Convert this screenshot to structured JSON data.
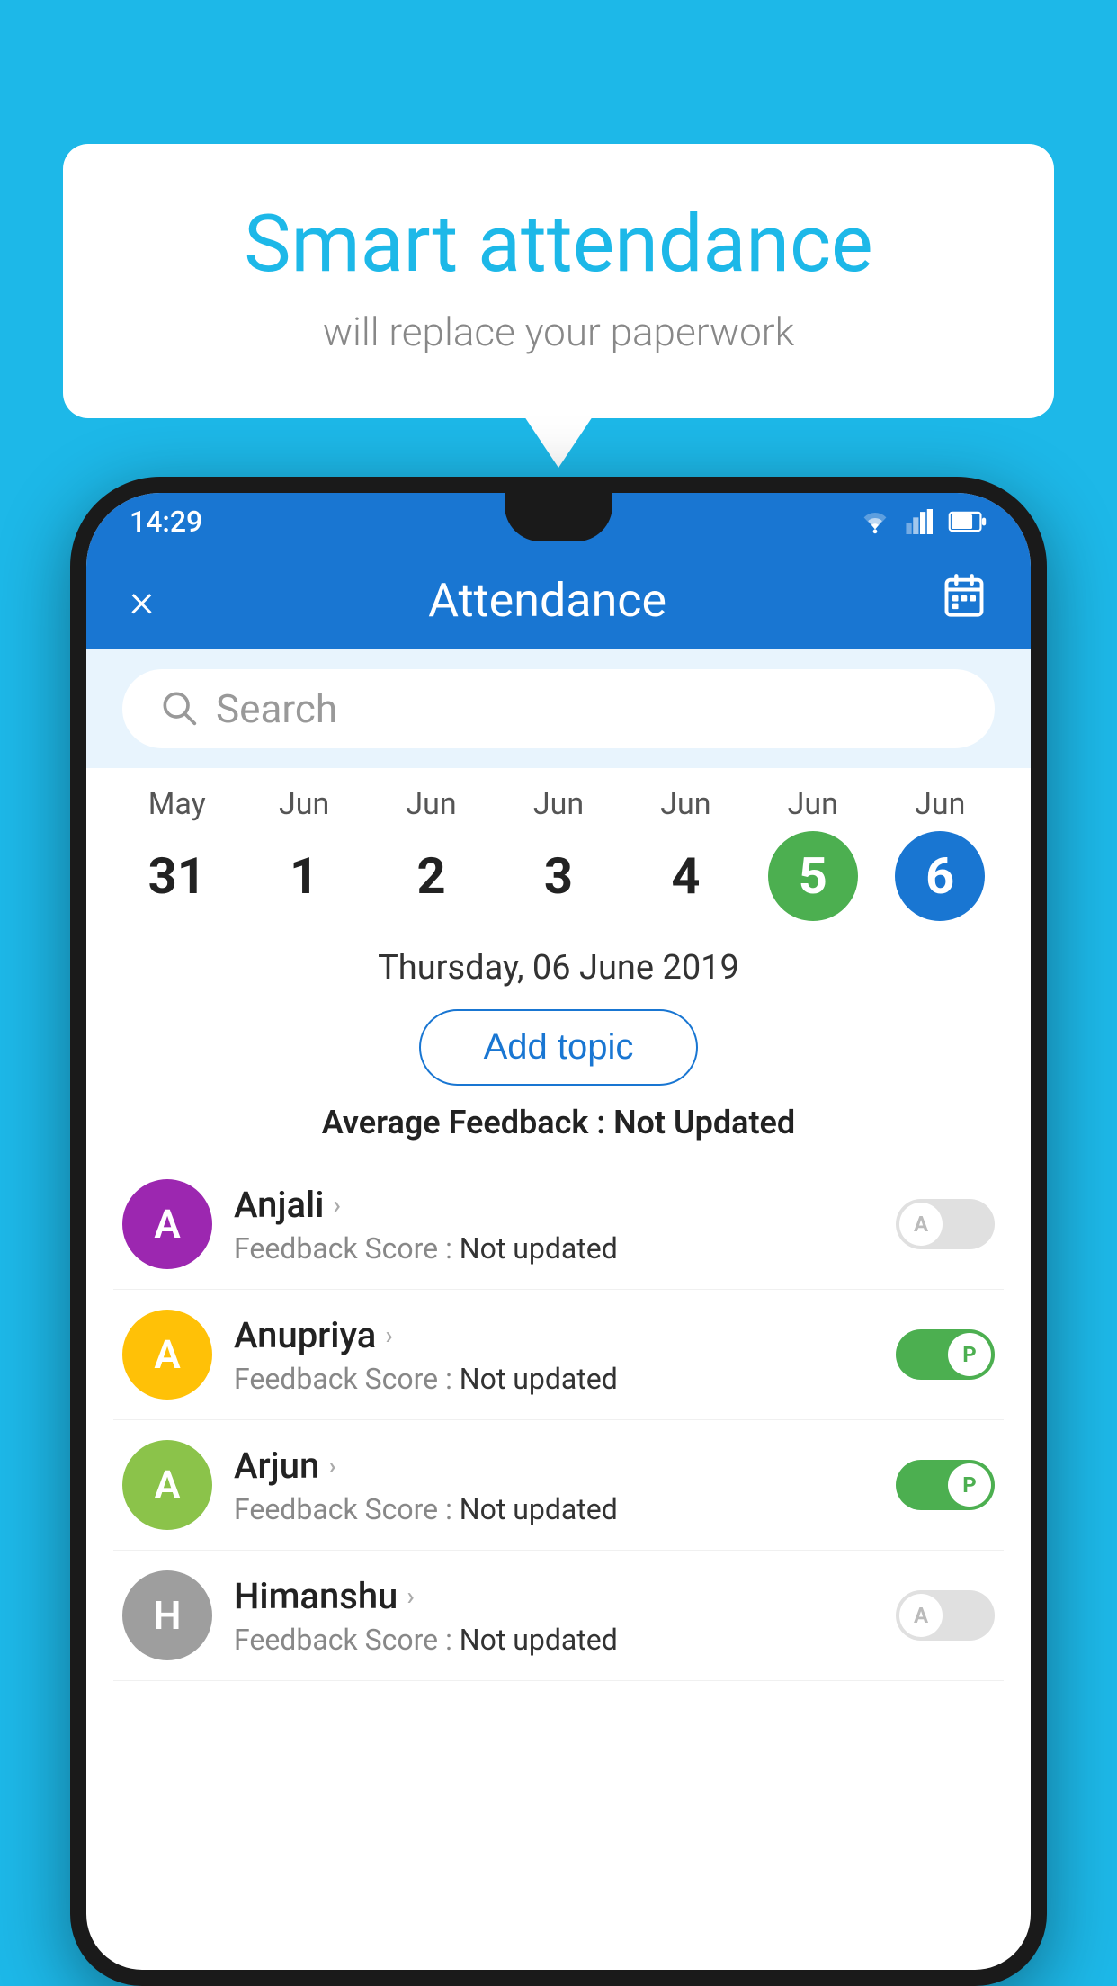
{
  "background_color": "#1DB8E8",
  "bubble": {
    "title": "Smart attendance",
    "subtitle": "will replace your paperwork"
  },
  "phone": {
    "status_bar": {
      "time": "14:29"
    },
    "header": {
      "close_label": "×",
      "title": "Attendance",
      "calendar_icon": "📅"
    },
    "search": {
      "placeholder": "Search"
    },
    "calendar": {
      "days": [
        {
          "month": "May",
          "date": "31",
          "state": "normal"
        },
        {
          "month": "Jun",
          "date": "1",
          "state": "normal"
        },
        {
          "month": "Jun",
          "date": "2",
          "state": "normal"
        },
        {
          "month": "Jun",
          "date": "3",
          "state": "normal"
        },
        {
          "month": "Jun",
          "date": "4",
          "state": "normal"
        },
        {
          "month": "Jun",
          "date": "5",
          "state": "today"
        },
        {
          "month": "Jun",
          "date": "6",
          "state": "selected"
        }
      ]
    },
    "selected_date": "Thursday, 06 June 2019",
    "add_topic_label": "Add topic",
    "avg_feedback_label": "Average Feedback :",
    "avg_feedback_value": "Not Updated",
    "students": [
      {
        "name": "Anjali",
        "avatar_letter": "A",
        "avatar_color": "#9C27B0",
        "feedback_label": "Feedback Score :",
        "feedback_value": "Not updated",
        "attendance": "absent",
        "toggle_letter": "A"
      },
      {
        "name": "Anupriya",
        "avatar_letter": "A",
        "avatar_color": "#FFC107",
        "feedback_label": "Feedback Score :",
        "feedback_value": "Not updated",
        "attendance": "present",
        "toggle_letter": "P"
      },
      {
        "name": "Arjun",
        "avatar_letter": "A",
        "avatar_color": "#8BC34A",
        "feedback_label": "Feedback Score :",
        "feedback_value": "Not updated",
        "attendance": "present",
        "toggle_letter": "P"
      },
      {
        "name": "Himanshu",
        "avatar_letter": "H",
        "avatar_color": "#9E9E9E",
        "feedback_label": "Feedback Score :",
        "feedback_value": "Not updated",
        "attendance": "absent",
        "toggle_letter": "A"
      }
    ]
  }
}
